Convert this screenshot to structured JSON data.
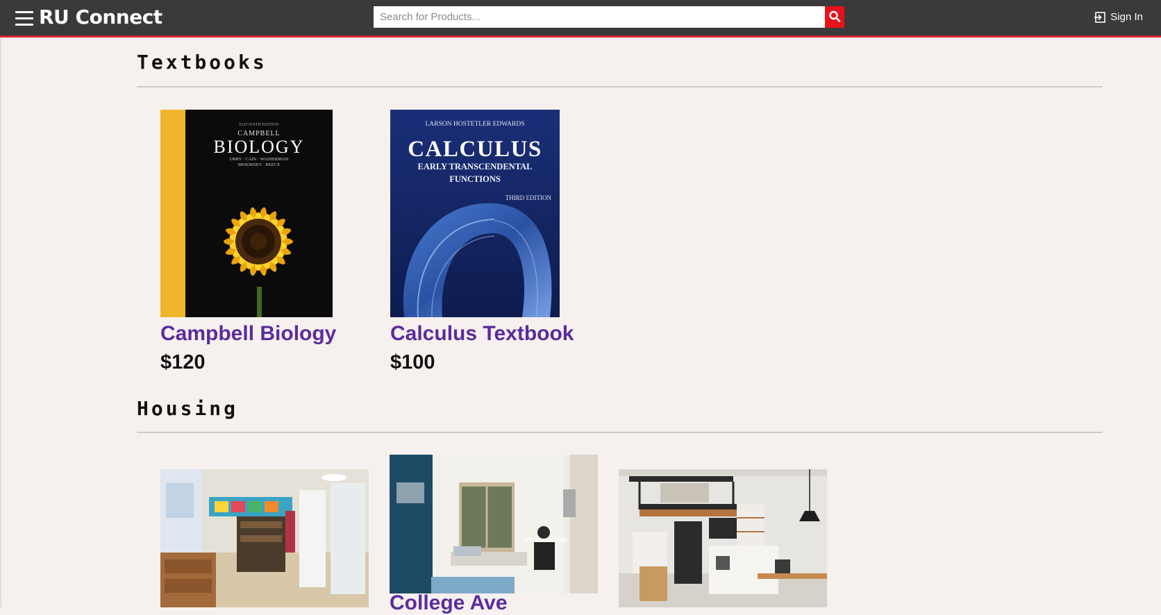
{
  "header": {
    "brand": "RU Connect",
    "search_placeholder": "Search for Products...",
    "signin_label": "Sign In"
  },
  "sections": [
    {
      "title": "Textbooks",
      "items": [
        {
          "name": "Campbell Biology",
          "price": "$120",
          "cover": {
            "edition": "ELEVENTH EDITION",
            "top": "CAMPBELL",
            "title": "BIOLOGY",
            "authors": "URRY · CAIN · WASSERMAN",
            "authors2": "MINORSKY · REECE"
          }
        },
        {
          "name": "Calculus Textbook",
          "price": "$100",
          "cover": {
            "authors": "LARSON   HOSTETLER   EDWARDS",
            "title": "CALCULUS",
            "subtitle1": "EARLY TRANSCENDENTAL",
            "subtitle2": "FUNCTIONS",
            "edition": "THIRD EDITION"
          }
        }
      ]
    },
    {
      "title": "Housing",
      "items": [
        {
          "name": ""
        },
        {
          "name": "College Ave"
        },
        {
          "name": ""
        }
      ]
    }
  ],
  "colors": {
    "header": "#3a3a3a",
    "accent": "#d2222a",
    "search_button": "#e8121c",
    "link": "#5b2c9c",
    "page": "#f6f1ef"
  },
  "icons": {
    "menu": "menu-icon",
    "search": "search-icon",
    "signin": "sign-in-icon"
  }
}
